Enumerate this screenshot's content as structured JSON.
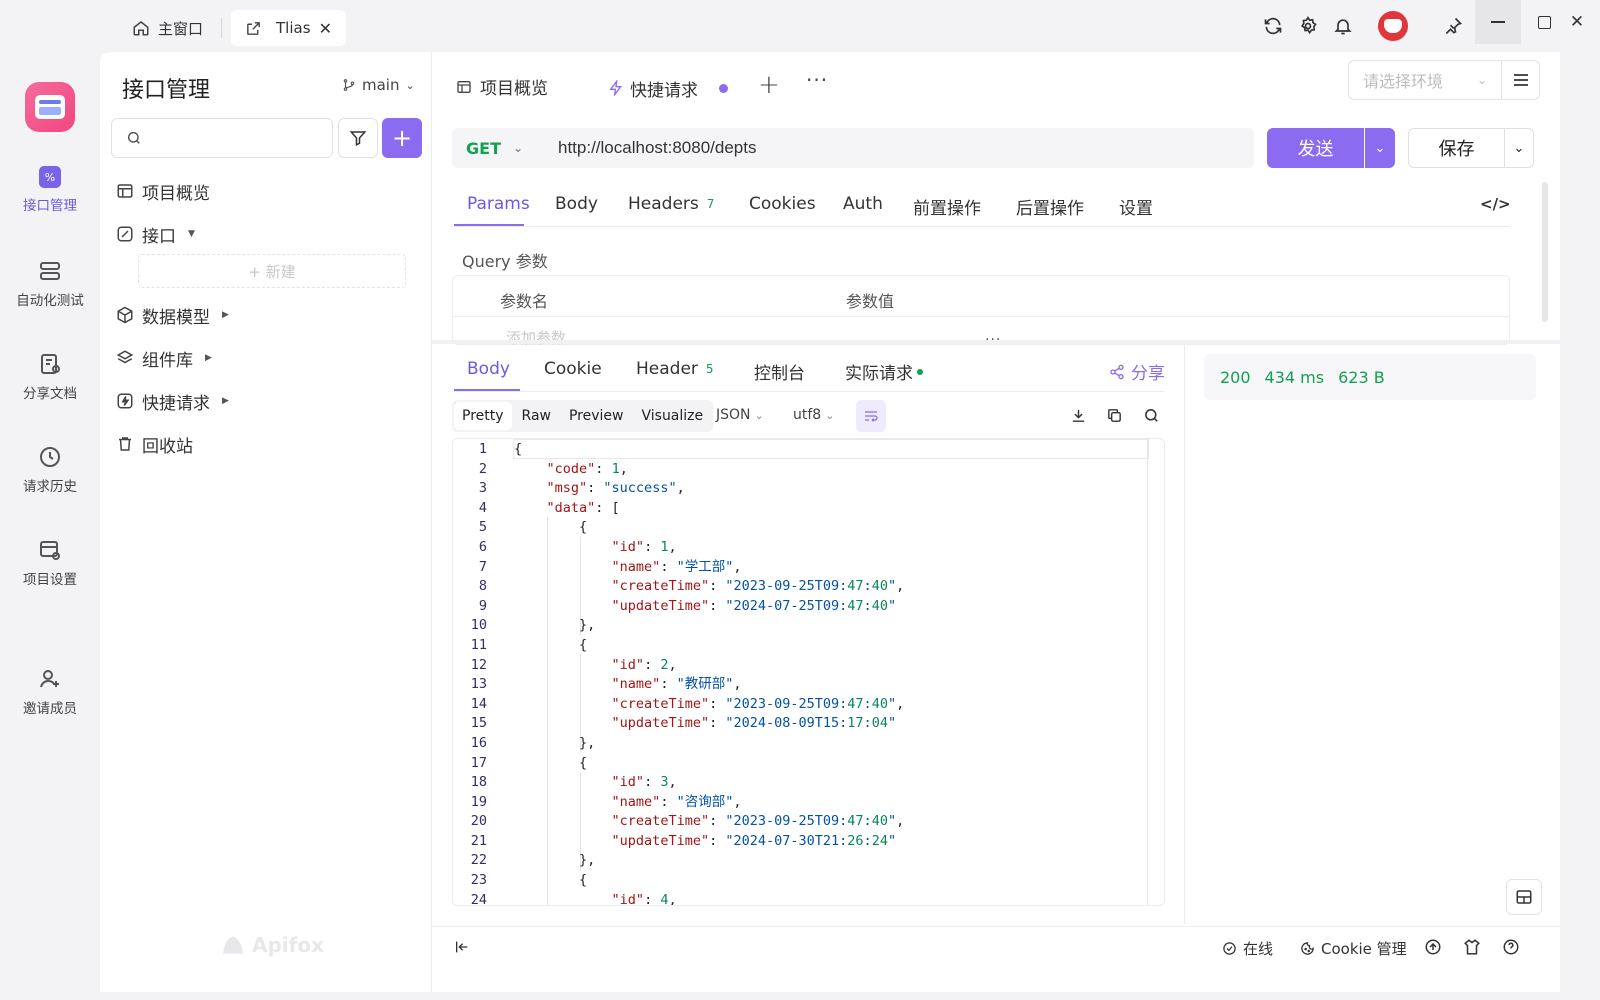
{
  "window": {
    "home_tab": "主窗口",
    "active_tab": "Tlias"
  },
  "rail": {
    "items": [
      "接口管理",
      "自动化测试",
      "分享文档",
      "请求历史",
      "项目设置",
      "邀请成员"
    ]
  },
  "sidebar": {
    "title": "接口管理",
    "branch": "main",
    "search_placeholder": "",
    "tree": [
      {
        "label": "项目概览"
      },
      {
        "label": "接口"
      },
      {
        "label": "数据模型"
      },
      {
        "label": "组件库"
      },
      {
        "label": "快捷请求"
      },
      {
        "label": "回收站"
      }
    ],
    "new_label": "+ 新建",
    "watermark": "Apifox"
  },
  "tabs": {
    "overview": "项目概览",
    "quick": "快捷请求",
    "env_placeholder": "请选择环境"
  },
  "request": {
    "method": "GET",
    "url": "http://localhost:8080/depts",
    "send": "发送",
    "save": "保存"
  },
  "req_tabs": {
    "params": "Params",
    "body": "Body",
    "headers": "Headers",
    "headers_count": "7",
    "cookies": "Cookies",
    "auth": "Auth",
    "pre": "前置操作",
    "post": "后置操作",
    "settings": "设置"
  },
  "query": {
    "title": "Query 参数",
    "col_name": "参数名",
    "col_value": "参数值",
    "add_placeholder": "添加参数"
  },
  "resp_tabs": {
    "body": "Body",
    "cookie": "Cookie",
    "header": "Header",
    "header_count": "5",
    "console": "控制台",
    "actual": "实际请求",
    "share": "分享"
  },
  "view": {
    "pretty": "Pretty",
    "raw": "Raw",
    "preview": "Preview",
    "visualize": "Visualize",
    "format": "JSON",
    "encoding": "utf8"
  },
  "response_meta": {
    "status": "200",
    "time": "434 ms",
    "size": "623 B"
  },
  "code_lines": [
    "{",
    "    \"code\": 1,",
    "    \"msg\": \"success\",",
    "    \"data\": [",
    "        {",
    "            \"id\": 1,",
    "            \"name\": \"学工部\",",
    "            \"createTime\": \"2023-09-25T09:47:40\",",
    "            \"updateTime\": \"2024-07-25T09:47:40\"",
    "        },",
    "        {",
    "            \"id\": 2,",
    "            \"name\": \"教研部\",",
    "            \"createTime\": \"2023-09-25T09:47:40\",",
    "            \"updateTime\": \"2024-08-09T15:17:04\"",
    "        },",
    "        {",
    "            \"id\": 3,",
    "            \"name\": \"咨询部\",",
    "            \"createTime\": \"2023-09-25T09:47:40\",",
    "            \"updateTime\": \"2024-07-30T21:26:24\"",
    "        },",
    "        {",
    "            \"id\": 4,"
  ],
  "footer": {
    "online": "在线",
    "cookie_mgmt": "Cookie 管理"
  },
  "colors": {
    "accent": "#8b6cf0",
    "get": "#12a150",
    "status_ok": "#12a150"
  }
}
